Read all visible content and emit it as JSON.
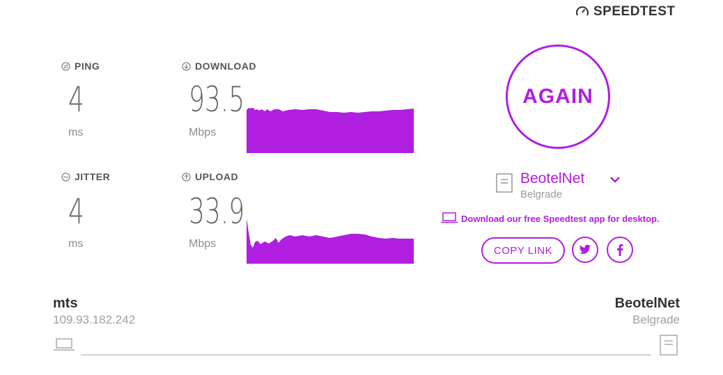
{
  "brand": {
    "name": "SPEEDTEST",
    "icon": "speedometer-icon"
  },
  "ping": {
    "label": "PING",
    "value": "4",
    "unit": "ms",
    "icon": "ping-icon"
  },
  "jitter": {
    "label": "JITTER",
    "value": "4",
    "unit": "ms",
    "icon": "jitter-icon"
  },
  "download": {
    "label": "DOWNLOAD",
    "value": "93.5",
    "unit": "Mbps",
    "icon": "download-arrow-icon"
  },
  "upload": {
    "label": "UPLOAD",
    "value": "33.9",
    "unit": "Mbps",
    "icon": "upload-arrow-icon"
  },
  "again_label": "AGAIN",
  "server": {
    "name": "BeotelNet",
    "location": "Belgrade",
    "icon": "server-icon",
    "chevron": "chevron-down-icon"
  },
  "promo_text": "Download our free Speedtest app for desktop.",
  "share": {
    "copy_link": "COPY LINK",
    "twitter_icon": "twitter-icon",
    "facebook_icon": "facebook-icon"
  },
  "client": {
    "isp": "mts",
    "ip": "109.93.182.242",
    "icon": "laptop-icon"
  },
  "host": {
    "name": "BeotelNet",
    "location": "Belgrade",
    "icon": "server-icon"
  },
  "colors": {
    "accent": "#b01ee0",
    "graph": "#b01ee0",
    "text": "#4a4a4a",
    "muted": "#9a9a9a"
  }
}
